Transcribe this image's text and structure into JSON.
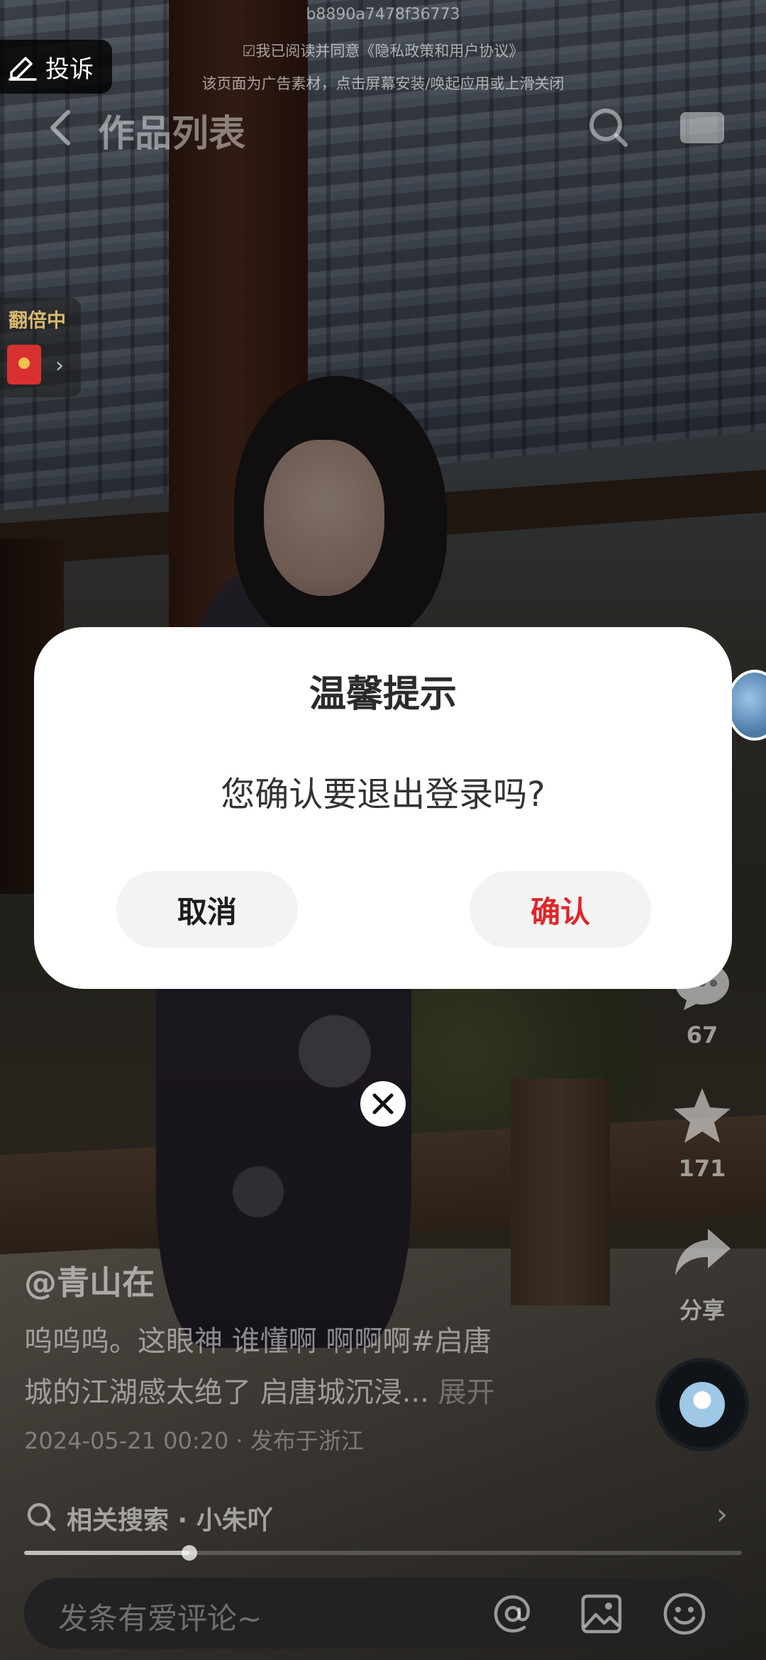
{
  "ad": {
    "id_text": "b8890a7478f36773",
    "agreement_text": "☑我已阅读并同意《隐私政策和用户协议》",
    "notice_text": "该页面为广告素材，点击屏幕安装/唤起应用或上滑关闭"
  },
  "report_button": {
    "label": "投诉"
  },
  "topbar": {
    "title": "作品列表"
  },
  "bonus": {
    "label": "翻倍中"
  },
  "actions": {
    "comment_count": "67",
    "favorite_count": "171",
    "share_label": "分享"
  },
  "video": {
    "author": "@青山在",
    "caption_line1": "呜呜呜。这眼神 谁懂啊 啊啊啊#启唐",
    "caption_line2": "城的江湖感太绝了 启唐城沉浸...",
    "expand_label": "展开",
    "meta": "2024-05-21 00:20 · 发布于浙江",
    "progress": 0.23
  },
  "related_search": {
    "text": "相关搜索 · 小朱吖"
  },
  "comment_input": {
    "placeholder": "发条有爱评论~"
  },
  "dialog": {
    "title": "温馨提示",
    "message": "您确认要退出登录吗?",
    "cancel_label": "取消",
    "confirm_label": "确认",
    "confirm_color": "#e0262a"
  },
  "icons": [
    "report-icon",
    "back-icon",
    "search-icon",
    "screen-icon",
    "redpacket-icon",
    "comment-icon",
    "star-icon",
    "share-icon",
    "music-disc-icon",
    "at-icon",
    "image-icon",
    "emoji-icon",
    "close-icon"
  ]
}
